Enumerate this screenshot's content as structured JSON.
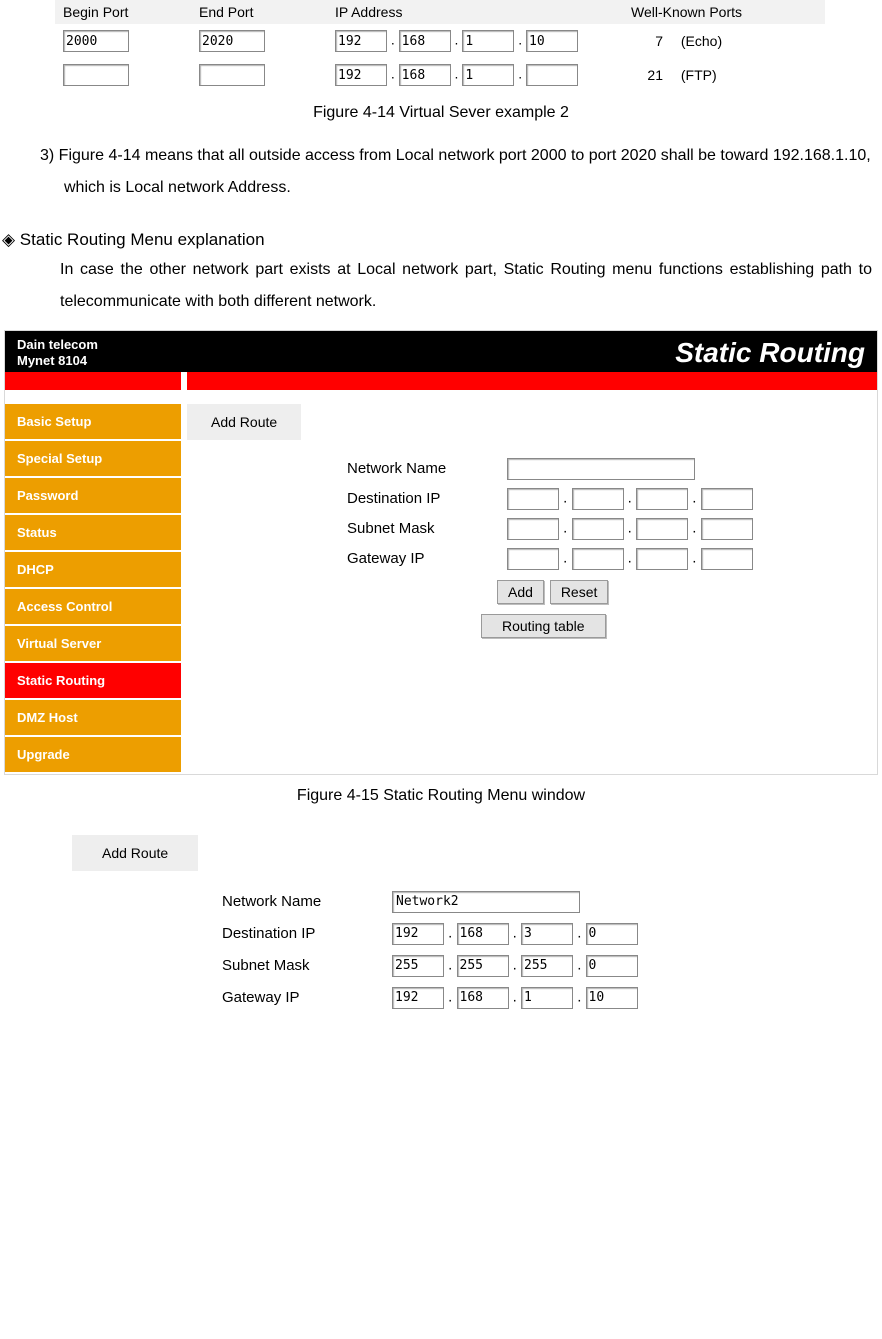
{
  "port_table": {
    "headers": [
      "Begin Port",
      "End Port",
      "IP Address",
      "Well-Known Ports"
    ],
    "rows": [
      {
        "begin": "2000",
        "end": "2020",
        "ip": [
          "192",
          "168",
          "1",
          "10"
        ],
        "wk_num": "7",
        "wk_name": "(Echo)"
      },
      {
        "begin": "",
        "end": "",
        "ip": [
          "192",
          "168",
          "1",
          ""
        ],
        "wk_num": "21",
        "wk_name": "(FTP)"
      }
    ]
  },
  "captions": {
    "fig414": "Figure 4-14 Virtual Sever example 2",
    "fig415": "Figure 4-15 Static Routing Menu window"
  },
  "paragraphs": {
    "p3": "3) Figure 4-14 means that all outside access from Local network port 2000 to port 2020 shall be toward 192.168.1.10, which is Local network Address.",
    "diamond": "◈ Static Routing Menu explanation",
    "diamond_body": "In case the other network part exists at Local network part, Static Routing menu functions establishing path to telecommunicate with both different network."
  },
  "router": {
    "brand1": "Dain telecom",
    "brand2": "Mynet 8104",
    "page_title": "Static Routing",
    "sidebar": [
      {
        "label": "Basic Setup",
        "active": false
      },
      {
        "label": "Special Setup",
        "active": false
      },
      {
        "label": "Password",
        "active": false
      },
      {
        "label": "Status",
        "active": false
      },
      {
        "label": "DHCP",
        "active": false
      },
      {
        "label": "Access Control",
        "active": false
      },
      {
        "label": "Virtual Server",
        "active": false
      },
      {
        "label": "Static Routing",
        "active": true
      },
      {
        "label": "DMZ Host",
        "active": false
      },
      {
        "label": "Upgrade",
        "active": false
      }
    ],
    "tab_label": "Add Route",
    "fields": {
      "network_name_label": "Network Name",
      "destination_ip_label": "Destination IP",
      "subnet_mask_label": "Subnet Mask",
      "gateway_ip_label": "Gateway IP"
    },
    "buttons": {
      "add": "Add",
      "reset": "Reset",
      "routing_table": "Routing table"
    }
  },
  "lower_form": {
    "tab_label": "Add Route",
    "fields": {
      "network_name_label": "Network Name",
      "destination_ip_label": "Destination IP",
      "subnet_mask_label": "Subnet Mask",
      "gateway_ip_label": "Gateway IP"
    },
    "values": {
      "network_name": "Network2",
      "dest": [
        "192",
        "168",
        "3",
        "0"
      ],
      "mask": [
        "255",
        "255",
        "255",
        "0"
      ],
      "gw": [
        "192",
        "168",
        "1",
        "10"
      ]
    }
  }
}
